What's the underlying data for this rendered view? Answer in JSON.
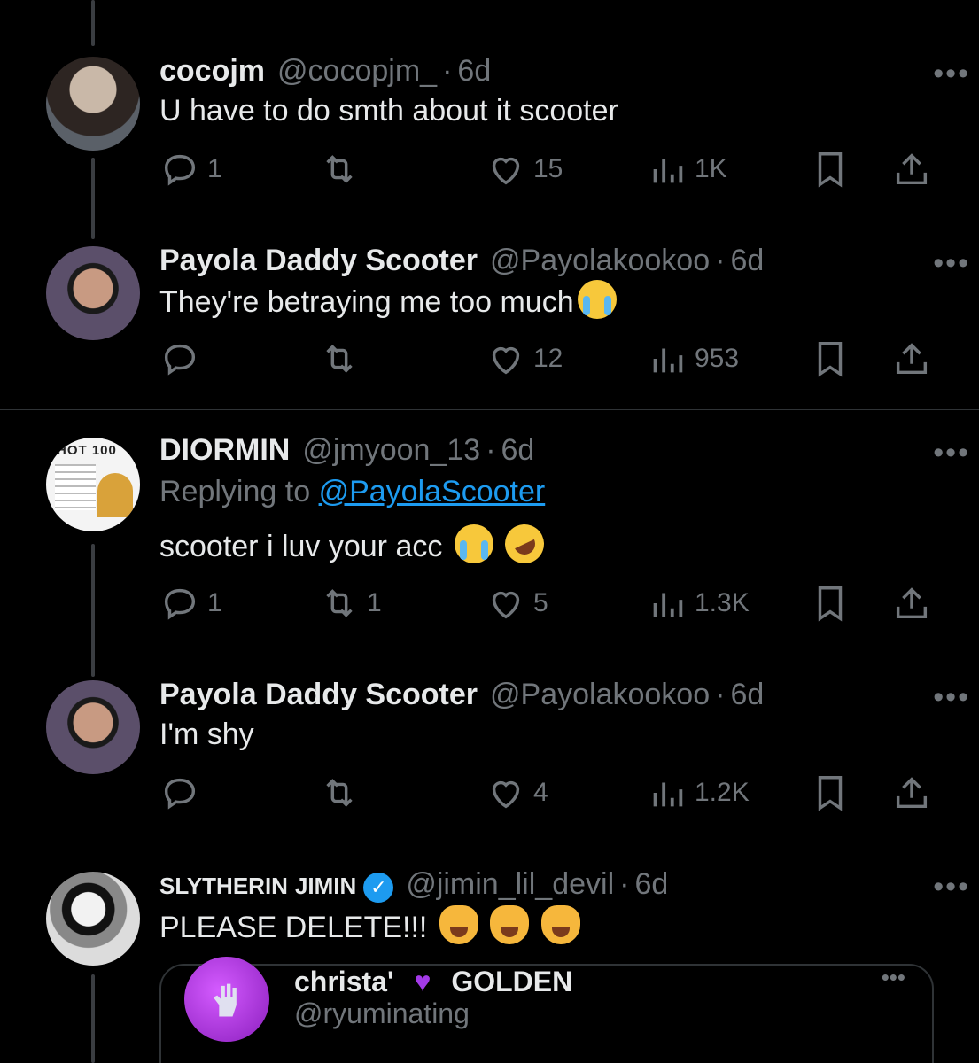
{
  "tweets": [
    {
      "name": "cocojm",
      "handle": "@cocopjm_",
      "time": "6d",
      "text": "U have to do smth about it scooter",
      "counts": {
        "reply": "1",
        "retweet": "",
        "like": "15",
        "views": "1K"
      }
    },
    {
      "name": "Payola Daddy Scooter",
      "handle": "@Payolakookoo",
      "time": "6d",
      "text": "They're betraying me too much",
      "counts": {
        "reply": "",
        "retweet": "",
        "like": "12",
        "views": "953"
      }
    },
    {
      "name": "DIORMIN",
      "handle": "@jmyoon_13",
      "time": "6d",
      "reply_prefix": "Replying to",
      "reply_target": "@PayolaScooter",
      "text": "scooter i luv your acc",
      "counts": {
        "reply": "1",
        "retweet": "1",
        "like": "5",
        "views": "1.3K"
      }
    },
    {
      "name": "Payola Daddy Scooter",
      "handle": "@Payolakookoo",
      "time": "6d",
      "text": "I'm shy",
      "counts": {
        "reply": "",
        "retweet": "",
        "like": "4",
        "views": "1.2K"
      }
    },
    {
      "name_prefix": "SLYTHERIN",
      "name": "JIMIN",
      "handle": "@jimin_lil_devil",
      "time": "6d",
      "text": "PLEASE DELETE!!!",
      "counts": {
        "reply": "",
        "retweet": "",
        "like": "",
        "views": ""
      }
    }
  ],
  "quote": {
    "name_left": "christa'",
    "name_right": "GOLDEN",
    "handle": "@ryuminating"
  },
  "avatar_label": "HOT 100",
  "separator": "·",
  "more": "•••",
  "colors": {
    "background": "#000000",
    "text": "#e7e9ea",
    "muted": "#71767b",
    "link": "#1d9bf0"
  }
}
